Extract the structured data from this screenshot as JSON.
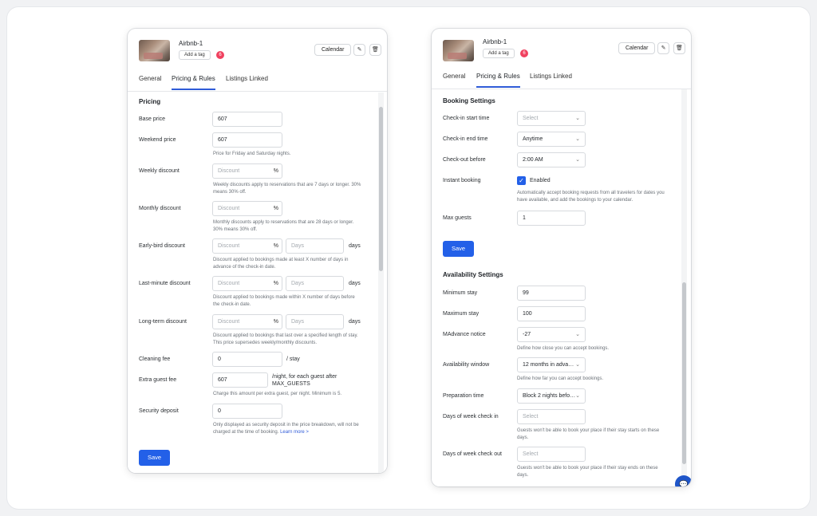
{
  "listing": {
    "name": "Airbnb-1",
    "add_tag": "Add a tag",
    "badge": "6"
  },
  "header": {
    "calendar": "Calendar"
  },
  "icons": {
    "edit": "pencil-icon",
    "delete": "trash-icon"
  },
  "tabs": {
    "general": "General",
    "pricing": "Pricing & Rules",
    "listings": "Listings Linked"
  },
  "pricing": {
    "title": "Pricing",
    "base_price": {
      "label": "Base price",
      "value": "607"
    },
    "weekend_price": {
      "label": "Weekend price",
      "value": "607",
      "help": "Price for Friday and Saturday nights."
    },
    "weekly_discount": {
      "label": "Weekly discount",
      "placeholder": "Discount",
      "unit": "%",
      "help1": "Weekly discounts apply to reservations that are 7 days or longer. 30%",
      "help2": "means 30% off."
    },
    "monthly_discount": {
      "label": "Monthly discount",
      "placeholder": "Discount",
      "unit": "%",
      "help1": "Monthly discounts apply to reservations that are 28 days or longer.",
      "help2": "30% means 30% off."
    },
    "early_bird": {
      "label": "Early-bird discount",
      "placeholder": "Discount",
      "unit": "%",
      "days_placeholder": "Days",
      "days_label": "days",
      "help1": "Discount applied to bookings made at least X number of days in",
      "help2": "advance of the check-in date."
    },
    "last_minute": {
      "label": "Last-minute discount",
      "placeholder": "Discount",
      "unit": "%",
      "days_placeholder": "Days",
      "days_label": "days",
      "help1": "Discount applied to bookings made within X number of days before",
      "help2": "the check-in date."
    },
    "long_term": {
      "label": "Long-term discount",
      "placeholder": "Discount",
      "unit": "%",
      "days_placeholder": "Days",
      "days_label": "days",
      "help1": "Discount applied to bookings that last over a specified length of stay.",
      "help2": "This price supersedes weekly/monthly discounts."
    },
    "cleaning_fee": {
      "label": "Cleaning fee",
      "value": "0",
      "suffix": "/ stay"
    },
    "extra_guest_fee": {
      "label": "Extra guest fee",
      "value": "607",
      "suffix1": "/night, for each guest after",
      "suffix2": "MAX_GUESTS",
      "help": "Charge this amount per extra guest, per night. Minimum is 5."
    },
    "security_deposit": {
      "label": "Security deposit",
      "value": "0",
      "help1": "Only displayed as security deposit in the price breakdown, will not be",
      "help2": "charged at the time of booking.",
      "learn_more": "Learn more >"
    },
    "save": "Save"
  },
  "booking": {
    "title": "Booking Settings",
    "checkin_start": {
      "label": "Check-in start time",
      "value": "Select"
    },
    "checkin_end": {
      "label": "Check-in end time",
      "value": "Anytime"
    },
    "checkout_before": {
      "label": "Check-out before",
      "value": "2:00 AM"
    },
    "instant_booking": {
      "label": "Instant booking",
      "value": "Enabled",
      "help1": "Automatically accept booking requests from all travelers for dates you",
      "help2": "have available, and add the bookings to your calendar."
    },
    "max_guests": {
      "label": "Max guests",
      "value": "1"
    },
    "save": "Save"
  },
  "availability": {
    "title": "Availability Settings",
    "min_stay": {
      "label": "Minimum stay",
      "value": "99"
    },
    "max_stay": {
      "label": "Maximum stay",
      "value": "100"
    },
    "advance_notice": {
      "label": "MAdvance notice",
      "value": "-27",
      "help": "Define how close you can accept bookings."
    },
    "availability_window": {
      "label": "Availability window",
      "value": "12 months in adva…",
      "help": "Define how far you can accept bookings."
    },
    "preparation_time": {
      "label": "Preparation time",
      "value": "Block 2 nights befo…"
    },
    "days_check_in": {
      "label": "Days of week check in",
      "placeholder": "Select",
      "help1": "Guests won't be able to book your place if their stay starts on these",
      "help2": "days."
    },
    "days_check_out": {
      "label": "Days of week check out",
      "placeholder": "Select",
      "help1": "Guests won't be able to book your place if their stay ends on these",
      "help2": "days."
    }
  }
}
